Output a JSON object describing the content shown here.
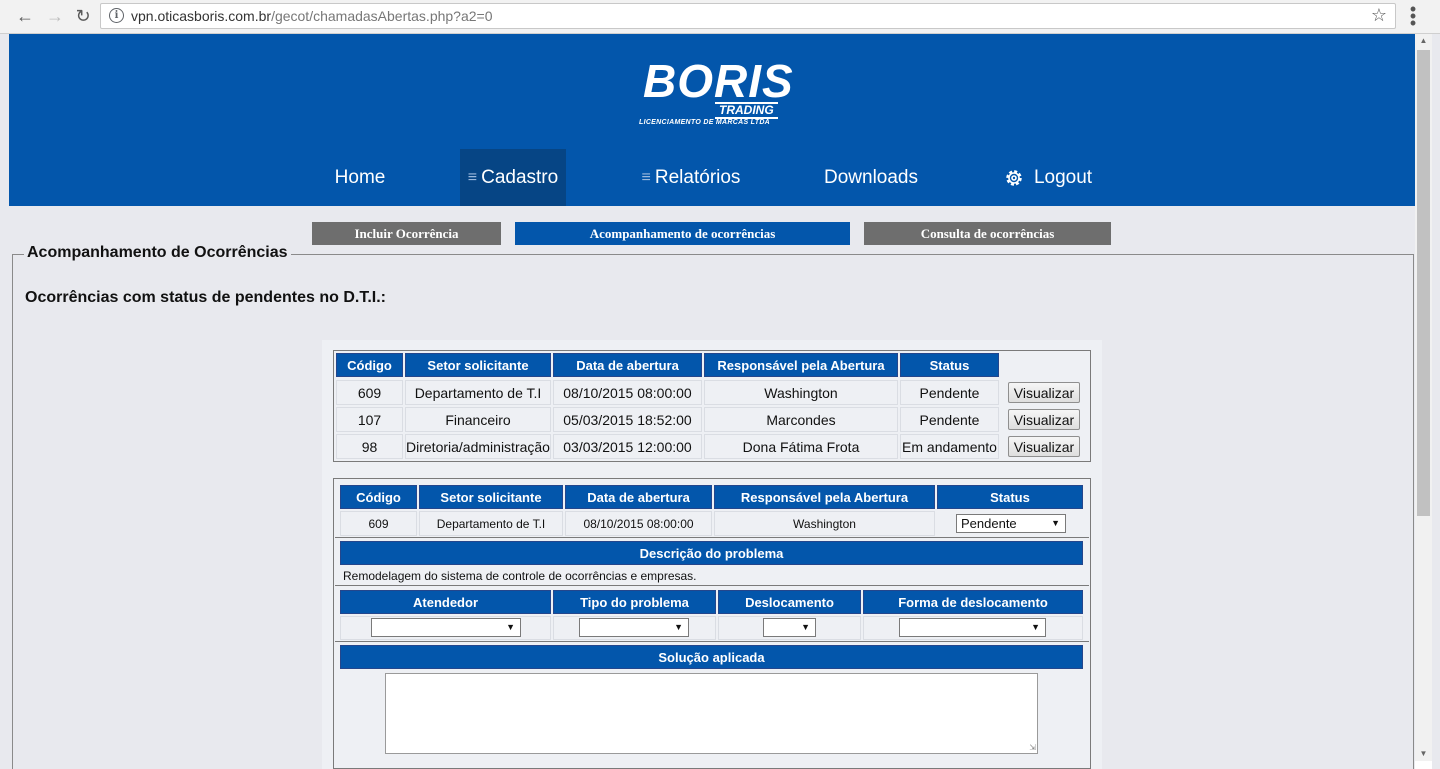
{
  "browser": {
    "url_host": "vpn.oticasboris.com.br",
    "url_path": "/gecot/chamadasAbertas.php?a2=0"
  },
  "logo": {
    "brand": "BORIS",
    "trading": "TRADING",
    "tagline": "LICENCIAMENTO DE MARCAS LTDA"
  },
  "menu": {
    "home": "Home",
    "cadastro": "Cadastro",
    "relatorios": "Relatórios",
    "downloads": "Downloads",
    "logout": "Logout"
  },
  "subtabs": {
    "incluir": "Incluir Ocorrência",
    "acompanhamento": "Acompanhamento de ocorrências",
    "consulta": "Consulta de ocorrências"
  },
  "fieldset_legend": "Acompanhamento de Ocorrências",
  "section_title": "Ocorrências com status de pendentes no D.T.I.:",
  "list": {
    "headers": [
      "Código",
      "Setor solicitante",
      "Data de abertura",
      "Responsável pela Abertura",
      "Status"
    ],
    "rows": [
      {
        "codigo": "609",
        "setor": "Departamento de T.I",
        "data": "08/10/2015 08:00:00",
        "responsavel": "Washington",
        "status": "Pendente",
        "action": "Visualizar"
      },
      {
        "codigo": "107",
        "setor": "Financeiro",
        "data": "05/03/2015 18:52:00",
        "responsavel": "Marcondes",
        "status": "Pendente",
        "action": "Visualizar"
      },
      {
        "codigo": "98",
        "setor": "Diretoria/administração",
        "data": "03/03/2015 12:00:00",
        "responsavel": "Dona Fátima Frota",
        "status": "Em andamento",
        "action": "Visualizar"
      }
    ]
  },
  "detail": {
    "headers": [
      "Código",
      "Setor solicitante",
      "Data de abertura",
      "Responsável pela Abertura",
      "Status"
    ],
    "row": {
      "codigo": "609",
      "setor": "Departamento de T.I",
      "data": "08/10/2015 08:00:00",
      "responsavel": "Washington",
      "status": "Pendente"
    },
    "descricao_header": "Descrição do problema",
    "descricao_text": "Remodelagem do sistema de controle de ocorrências e empresas.",
    "form_headers": [
      "Atendedor",
      "Tipo do problema",
      "Deslocamento",
      "Forma de deslocamento"
    ],
    "atendedor": "",
    "tipo": "",
    "deslocamento": "",
    "forma": "",
    "solucao_header": "Solução aplicada",
    "solucao_text": ""
  },
  "colors": {
    "brand_blue": "#0356ab",
    "active_menu": "#064585",
    "page_bg": "#e8e9ee",
    "tab_gray": "#6e6e6e"
  }
}
